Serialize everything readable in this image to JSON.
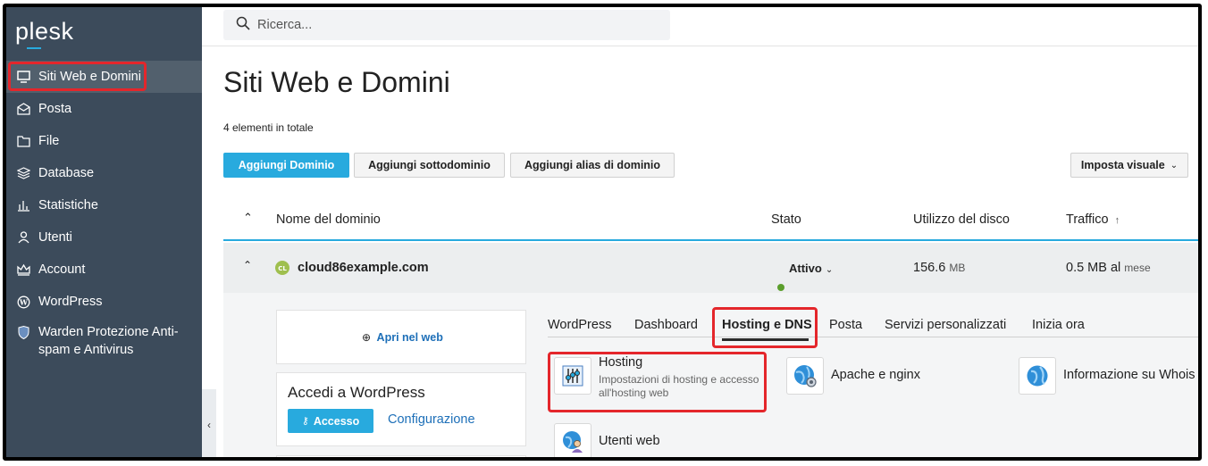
{
  "app": {
    "logo": "plesk"
  },
  "sidebar": {
    "items": [
      {
        "label": "Siti Web e Domini",
        "icon": "monitor-icon",
        "active": true
      },
      {
        "label": "Posta",
        "icon": "envelope-icon"
      },
      {
        "label": "File",
        "icon": "folder-icon"
      },
      {
        "label": "Database",
        "icon": "database-icon"
      },
      {
        "label": "Statistiche",
        "icon": "bar-chart-icon"
      },
      {
        "label": "Utenti",
        "icon": "user-icon"
      },
      {
        "label": "Account",
        "icon": "crown-icon"
      },
      {
        "label": "WordPress",
        "icon": "wordpress-icon"
      },
      {
        "label": "Warden Protezione Anti-spam e Antivirus",
        "icon": "shield-icon"
      }
    ]
  },
  "search": {
    "placeholder": "Ricerca..."
  },
  "page": {
    "title": "Siti Web e Domini",
    "total": "4 elementi in totale"
  },
  "toolbar": {
    "add_domain": "Aggiungi Dominio",
    "add_subdomain": "Aggiungi sottodominio",
    "add_alias": "Aggiungi alias di dominio",
    "view": "Imposta visuale"
  },
  "table": {
    "headers": {
      "name": "Nome del dominio",
      "status": "Stato",
      "disk": "Utilizzo del disco",
      "traffic": "Traffico"
    },
    "row": {
      "avatar": "CL",
      "domain": "cloud86example.com",
      "status": "Attivo",
      "disk_value": "156.6",
      "disk_unit": "MB",
      "traffic_value": "0.5 MB al",
      "traffic_unit": "mese"
    }
  },
  "panel": {
    "open_web": "Apri nel web",
    "wp_title": "Accedi a WordPress",
    "wp_login": "Accesso",
    "wp_config": "Configurazione"
  },
  "tabs": [
    "WordPress",
    "Dashboard",
    "Hosting e DNS",
    "Posta",
    "Servizi personalizzati",
    "Inizia ora"
  ],
  "tools": {
    "hosting": {
      "label": "Hosting",
      "desc": "Impostazioni di hosting e accesso all'hosting web"
    },
    "apache": {
      "label": "Apache e nginx"
    },
    "whois": {
      "label": "Informazione su Whois"
    },
    "webusers": {
      "label": "Utenti web"
    }
  },
  "colors": {
    "accent": "#28aade",
    "sidebar": "#3c4b5b",
    "highlight": "#e4262b",
    "status_ok": "#5b9e2c"
  }
}
